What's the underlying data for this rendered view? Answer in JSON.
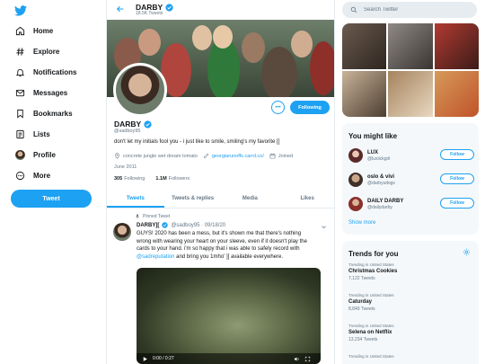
{
  "nav": {
    "items": [
      {
        "label": "Home",
        "icon": "home-icon"
      },
      {
        "label": "Explore",
        "icon": "hashtag-icon"
      },
      {
        "label": "Notifications",
        "icon": "bell-icon"
      },
      {
        "label": "Messages",
        "icon": "mail-icon"
      },
      {
        "label": "Bookmarks",
        "icon": "bookmark-icon"
      },
      {
        "label": "Lists",
        "icon": "list-icon"
      },
      {
        "label": "Profile",
        "icon": "avatar-icon"
      },
      {
        "label": "More",
        "icon": "more-icon"
      }
    ],
    "tweet_button": "Tweet"
  },
  "header": {
    "name": "DARBY",
    "tweet_count": "18.5K Tweets"
  },
  "profile": {
    "more_label": "•••",
    "follow_label": "Following",
    "name": "DARBY",
    "handle": "@sadboy95",
    "bio": "don't let my initials fool you - i just like to smile, smiling's my favorite [[",
    "location": "concrete jungle wet dream tomato",
    "website": "georgiarunoffs.carrd.co/",
    "joined_label": "Joined",
    "joined_date": "June 2011",
    "following_count": "305",
    "following_label": "Following",
    "followers_count": "1.1M",
    "followers_label": "Followers"
  },
  "tabs": [
    "Tweets",
    "Tweets & replies",
    "Media",
    "Likes"
  ],
  "pinned_tweet": {
    "pinned_label": "Pinned Tweet",
    "name": "DARBY][",
    "handle_date": "@sadboy95 · 09/18/20",
    "text_line1": "GUYS! 2020 has been a mess, but it's shown me that there's nothing",
    "text_line2": "wrong with wearing your heart on your sleeve, even if it doesn't play the",
    "text_line3": "cards to your hand. i'm so happy that i was able to safely record with",
    "mention": "@sadreputation",
    "text_line4_rest": " and bring you 1mho' ][ available everywhere.",
    "video_time": "0:00 / 0:27"
  },
  "search": {
    "placeholder": "Search Twitter"
  },
  "might_like": {
    "title": "You might like",
    "users": [
      {
        "name": "LUX",
        "handle": "@luxiickgirl",
        "button": "Follow"
      },
      {
        "name": "oslo & vivi",
        "handle": "@darbysdogs",
        "button": "Follow"
      },
      {
        "name": "DAILY DARBY",
        "handle": "@dailydarby",
        "button": "Follow"
      }
    ],
    "show_more": "Show more"
  },
  "trends": {
    "title": "Trends for you",
    "items": [
      {
        "context": "Trending in United States",
        "name": "Christmas Cookies",
        "count": "7,122 Tweets"
      },
      {
        "context": "Trending in United States",
        "name": "Caturday",
        "count": "8,849 Tweets"
      },
      {
        "context": "Trending in United States",
        "name": "Selena on Netflix",
        "count": "13,234 Tweets"
      },
      {
        "context": "Trending in United States",
        "name": "",
        "count": ""
      }
    ]
  },
  "colors": {
    "accent": "#1da1f2",
    "text": "#14171a",
    "muted": "#657786",
    "panel": "#f5f8fa"
  }
}
